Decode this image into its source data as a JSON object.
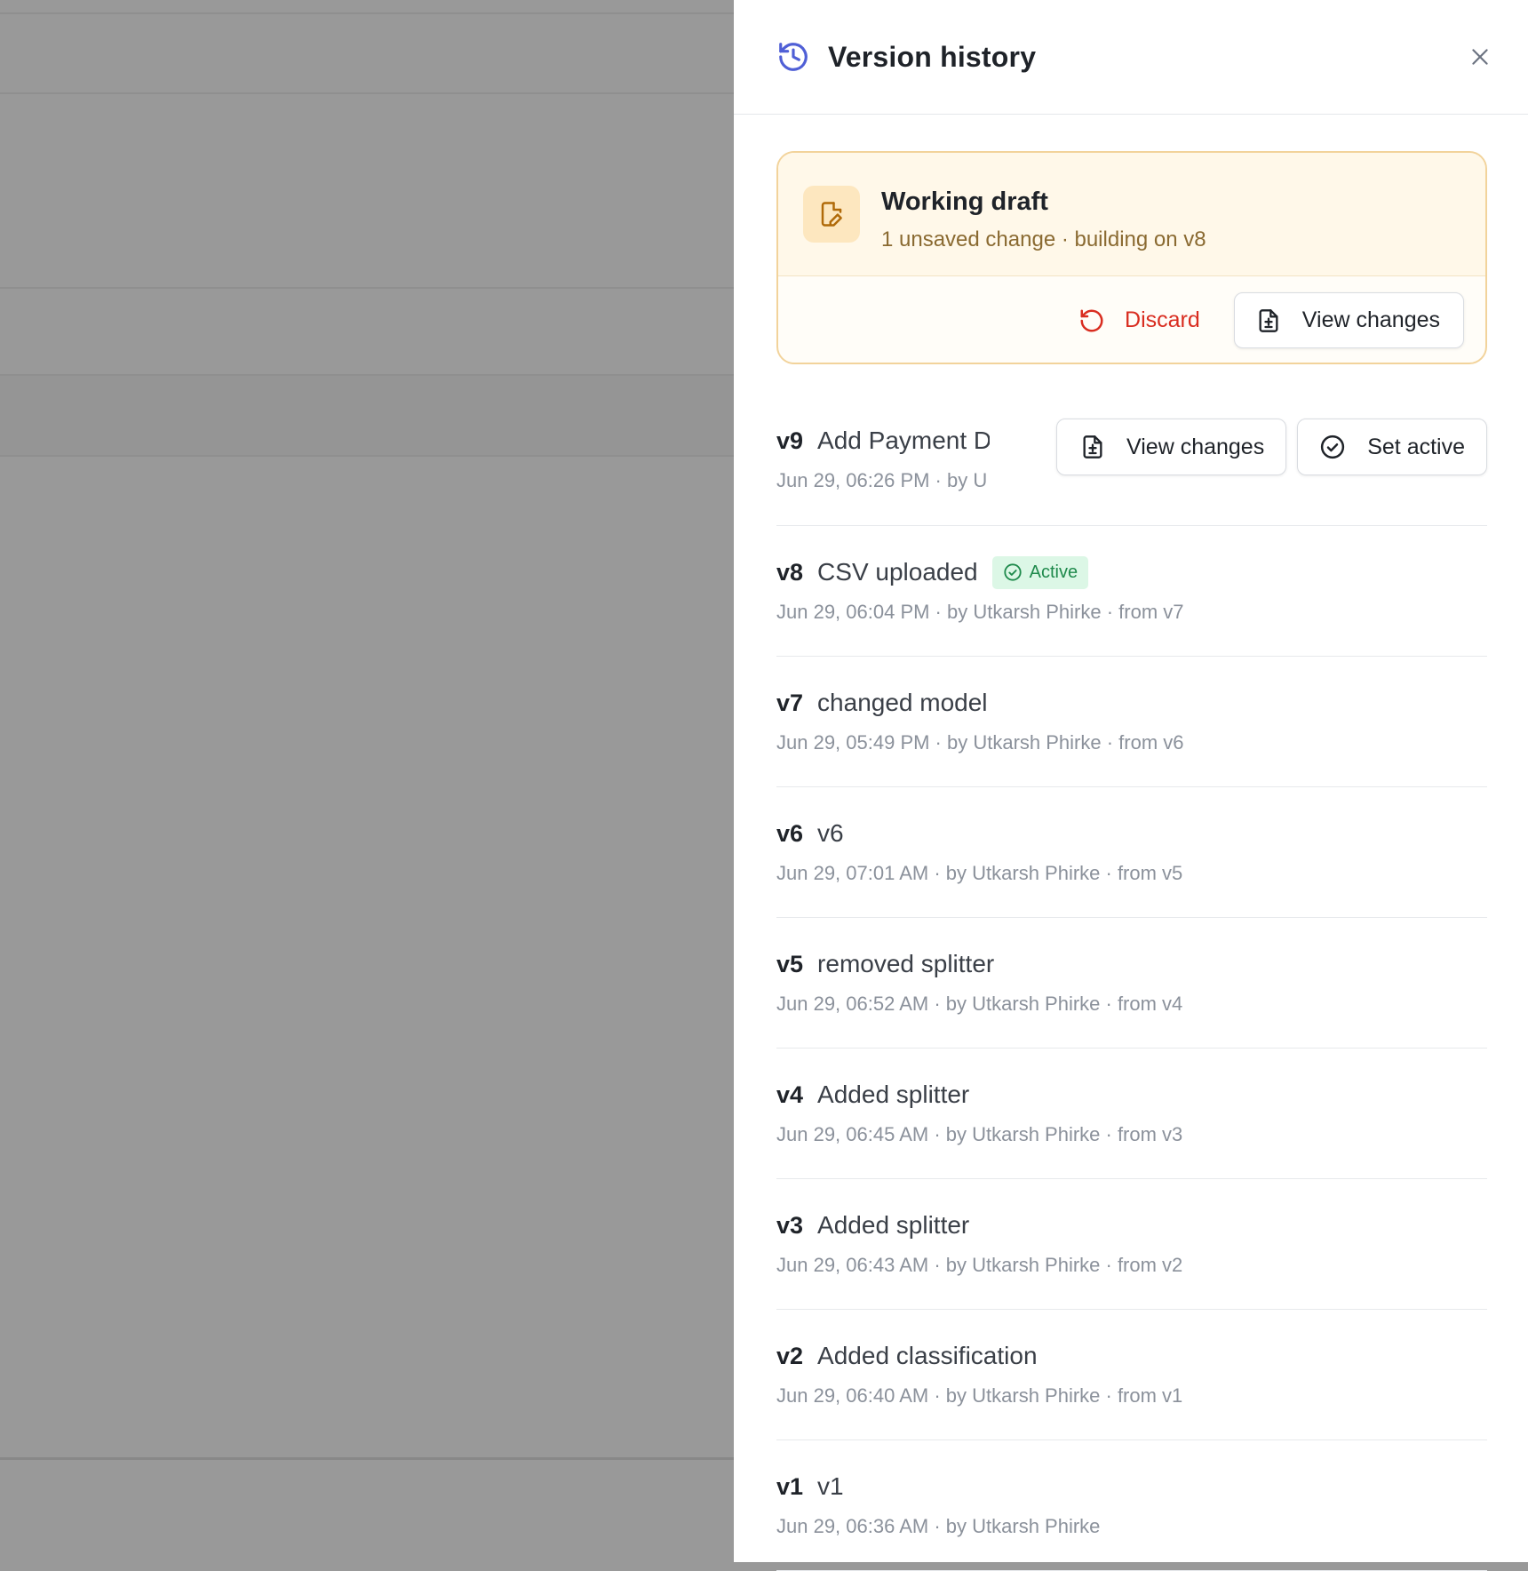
{
  "panel": {
    "title": "Version history",
    "close_label": "close"
  },
  "draft": {
    "title": "Working draft",
    "subtitle": "1 unsaved change · building on v8",
    "discard_label": "Discard",
    "view_changes_label": "View changes"
  },
  "row_actions": {
    "view_changes_label": "View changes",
    "set_active_label": "Set active"
  },
  "versions": [
    {
      "num": "v9",
      "name": "Add Payment D",
      "meta": "Jun 29, 06:26 PM · by U"
    },
    {
      "num": "v8",
      "name": "CSV uploaded",
      "meta": "Jun 29, 06:04 PM · by Utkarsh Phirke · from v7",
      "badge": "Active"
    },
    {
      "num": "v7",
      "name": "changed model",
      "meta": "Jun 29, 05:49 PM · by Utkarsh Phirke · from v6"
    },
    {
      "num": "v6",
      "name": "v6",
      "meta": "Jun 29, 07:01 AM · by Utkarsh Phirke · from v5"
    },
    {
      "num": "v5",
      "name": "removed splitter",
      "meta": "Jun 29, 06:52 AM · by Utkarsh Phirke · from v4"
    },
    {
      "num": "v4",
      "name": "Added splitter",
      "meta": "Jun 29, 06:45 AM · by Utkarsh Phirke · from v3"
    },
    {
      "num": "v3",
      "name": "Added splitter",
      "meta": "Jun 29, 06:43 AM · by Utkarsh Phirke · from v2"
    },
    {
      "num": "v2",
      "name": "Added classification",
      "meta": "Jun 29, 06:40 AM · by Utkarsh Phirke · from v1"
    },
    {
      "num": "v1",
      "name": "v1",
      "meta": "Jun 29, 06:36 AM · by Utkarsh Phirke"
    }
  ],
  "colors": {
    "accent": "#4f5fd6",
    "danger": "#d92d20",
    "draft_bg": "#fff8e9",
    "active_badge_bg": "#dcf7e6"
  }
}
